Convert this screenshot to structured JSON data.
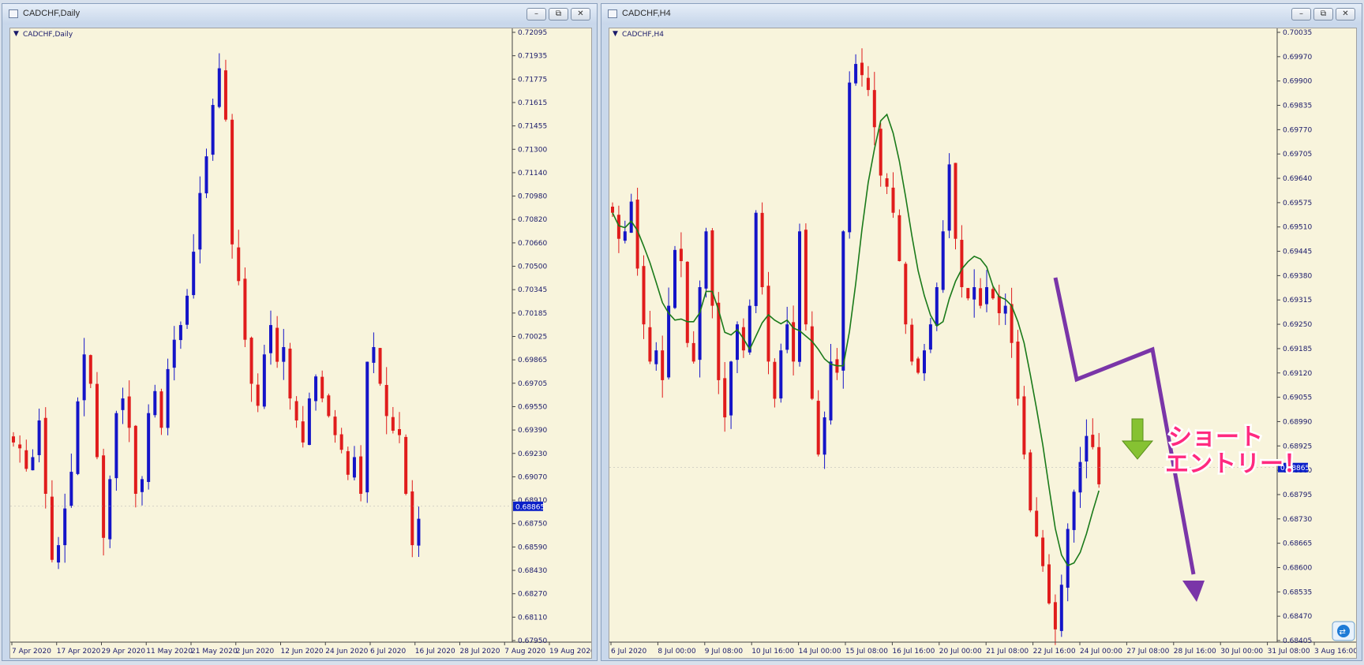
{
  "windows": {
    "daily": {
      "title": "CADCHF,Daily",
      "chart_label": "CADCHF,Daily"
    },
    "h4": {
      "title": "CADCHF,H4",
      "chart_label": "CADCHF,H4"
    }
  },
  "window_buttons": {
    "minimize": "–",
    "restore": "⧉",
    "close": "✕"
  },
  "annotation": {
    "line1": "ショート",
    "line2": "エントリー！"
  },
  "colors": {
    "bg": "#f8f4dc",
    "bull": "#1414c8",
    "bear": "#e01c1c",
    "ma": "#1a7a1a",
    "arrow": "#7a35a8",
    "entry_arrow": "#86c232",
    "price_tag": "#0a1fc8"
  },
  "chart_data": [
    {
      "type": "candlestick",
      "title": "CADCHF,Daily",
      "ylim": [
        0.6795,
        0.72095
      ],
      "y_ticks": [
        "0.72095",
        "0.71935",
        "0.71775",
        "0.71615",
        "0.71455",
        "0.71300",
        "0.71140",
        "0.70980",
        "0.70820",
        "0.70660",
        "0.70500",
        "0.70345",
        "0.70185",
        "0.70025",
        "0.69865",
        "0.69705",
        "0.69550",
        "0.69390",
        "0.69230",
        "0.69070",
        "0.68910",
        "0.68750",
        "0.68590",
        "0.68430",
        "0.68270",
        "0.68110",
        "0.67950"
      ],
      "x_ticks": [
        "7 Apr 2020",
        "17 Apr 2020",
        "29 Apr 2020",
        "11 May 2020",
        "21 May 2020",
        "2 Jun 2020",
        "12 Jun 2020",
        "24 Jun 2020",
        "6 Jul 2020",
        "16 Jul 2020",
        "28 Jul 2020",
        "7 Aug 2020",
        "19 Aug 2020"
      ],
      "current_price": "0.68865",
      "close_path": [
        0.693,
        0.6926,
        0.6912,
        0.692,
        0.6945,
        0.6895,
        0.685,
        0.686,
        0.6885,
        0.691,
        0.6958,
        0.699,
        0.697,
        0.692,
        0.6865,
        0.6905,
        0.695,
        0.696,
        0.694,
        0.6895,
        0.6905,
        0.695,
        0.6965,
        0.694,
        0.698,
        0.7,
        0.701,
        0.703,
        0.706,
        0.71,
        0.7125,
        0.716,
        0.7185,
        0.715,
        0.7065,
        0.704,
        0.7,
        0.697,
        0.6955,
        0.699,
        0.701,
        0.6985,
        0.6995,
        0.696,
        0.6945,
        0.693,
        0.696,
        0.6975,
        0.696,
        0.6948,
        0.6935,
        0.6925,
        0.6908,
        0.692,
        0.6895,
        0.6985,
        0.6995,
        0.697,
        0.6948,
        0.6938,
        0.6935,
        0.6895,
        0.686,
        0.6878
      ]
    },
    {
      "type": "candlestick",
      "title": "CADCHF,H4",
      "ylim": [
        0.684,
        0.70035
      ],
      "y_ticks": [
        "0.70035",
        "0.69970",
        "0.69900",
        "0.69835",
        "0.69770",
        "0.69705",
        "0.69640",
        "0.69575",
        "0.69510",
        "0.69445",
        "0.69380",
        "0.69315",
        "0.69250",
        "0.69185",
        "0.69120",
        "0.69055",
        "0.68990",
        "0.68925",
        "0.68860",
        "0.68795",
        "0.68730",
        "0.68665",
        "0.68600",
        "0.68535",
        "0.68470",
        "0.68405"
      ],
      "x_ticks": [
        "6 Jul 2020",
        "8 Jul 00:00",
        "9 Jul 08:00",
        "10 Jul 16:00",
        "14 Jul 00:00",
        "15 Jul 08:00",
        "16 Jul 16:00",
        "20 Jul 00:00",
        "21 Jul 08:00",
        "22 Jul 16:00",
        "24 Jul 00:00",
        "27 Jul 08:00",
        "28 Jul 16:00",
        "30 Jul 00:00",
        "31 Jul 08:00",
        "3 Aug 16:00"
      ],
      "current_price": "0.68865",
      "series": [
        {
          "name": "",
          "type": "moving-average"
        }
      ],
      "close_path": [
        0.6955,
        0.6948,
        0.695,
        0.6958,
        0.694,
        0.6925,
        0.6915,
        0.6918,
        0.691,
        0.693,
        0.6945,
        0.6942,
        0.692,
        0.6915,
        0.6935,
        0.695,
        0.693,
        0.691,
        0.69,
        0.6915,
        0.6925,
        0.6918,
        0.693,
        0.6955,
        0.6935,
        0.6915,
        0.6905,
        0.6918,
        0.6925,
        0.6915,
        0.695,
        0.6925,
        0.6905,
        0.689,
        0.69,
        0.6915,
        0.6912,
        0.695,
        0.699,
        0.6995,
        0.6992,
        0.6988,
        0.6978,
        0.6965,
        0.6962,
        0.6955,
        0.6942,
        0.6925,
        0.6915,
        0.6912,
        0.6918,
        0.6925,
        0.6935,
        0.695,
        0.6968,
        0.6948,
        0.6935,
        0.6932,
        0.6935,
        0.693,
        0.6935,
        0.6932,
        0.6928,
        0.693,
        0.692,
        0.6905,
        0.689,
        0.6875,
        0.6868,
        0.686,
        0.685,
        0.6843,
        0.6855,
        0.687,
        0.688,
        0.6888,
        0.6895,
        0.6892,
        0.6882
      ]
    }
  ]
}
